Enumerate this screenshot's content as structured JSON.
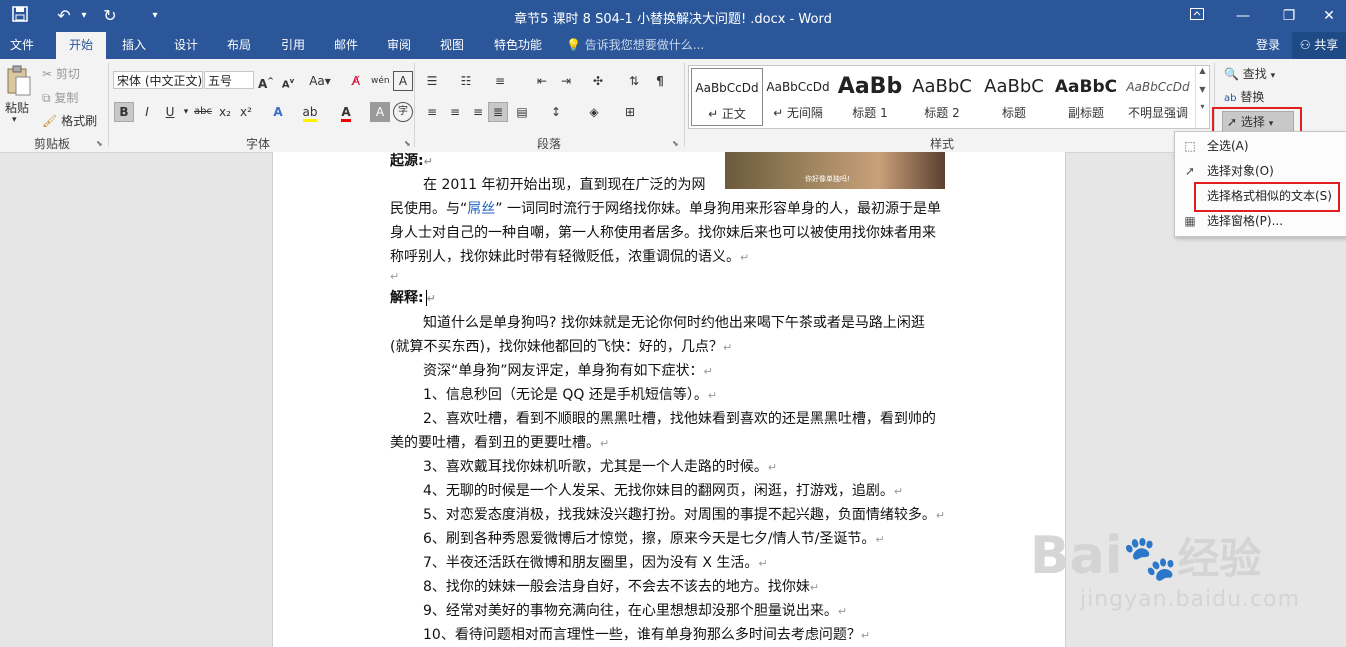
{
  "window": {
    "title": "章节5 课时 8 S04-1 小替换解决大问题! .docx - Word",
    "restore_icon": "restore-icon",
    "minimize_icon": "minimize-icon",
    "maximize_icon": "maximize-icon",
    "close_icon": "close-icon"
  },
  "tabs": [
    "文件",
    "开始",
    "插入",
    "设计",
    "布局",
    "引用",
    "邮件",
    "审阅",
    "视图",
    "特色功能"
  ],
  "tell_me": "告诉我您想要做什么...",
  "account": {
    "login": "登录",
    "share": "共享"
  },
  "clipboard": {
    "paste": "粘贴",
    "cut": "剪切",
    "copy": "复制",
    "format_painter": "格式刷",
    "label": "剪贴板"
  },
  "font": {
    "name": "宋体 (中文正文)",
    "size": "五号",
    "label": "字体",
    "aa": "Aa",
    "wen": "wén",
    "bold": "B",
    "italic": "I",
    "underline": "U",
    "strike": "abc",
    "sub": "x₂",
    "sup": "x²",
    "a_up": "A",
    "a_down": "A"
  },
  "paragraph": {
    "label": "段落"
  },
  "styles": {
    "label": "样式",
    "items": [
      {
        "preview": "AaBbCcDd",
        "name": "↵ 正文"
      },
      {
        "preview": "AaBbCcDd",
        "name": "↵ 无间隔"
      },
      {
        "preview": "AaBb",
        "name": "标题 1"
      },
      {
        "preview": "AaBbC",
        "name": "标题 2"
      },
      {
        "preview": "AaBbC",
        "name": "标题"
      },
      {
        "preview": "AaBbC",
        "name": "副标题"
      },
      {
        "preview": "AaBbCcDd",
        "name": "不明显强调"
      }
    ]
  },
  "editing": {
    "find": "查找",
    "replace": "替换",
    "select": "选择"
  },
  "menu": {
    "items": [
      {
        "label": "全选(A)",
        "icon": "select-all-icon"
      },
      {
        "label": "选择对象(O)",
        "icon": "cursor-icon"
      },
      {
        "label": "选择格式相似的文本(S)",
        "icon": ""
      },
      {
        "label": "选择窗格(P)...",
        "icon": "selection-pane-icon"
      }
    ]
  },
  "doc": {
    "origin_label": "起源:",
    "image_caption": "你好像单独吗!",
    "l1": "在 2011 年初开始出现，直到现在广泛的为网",
    "l2a": "民使用。与“",
    "l2b": "屌丝",
    "l2c": "” 一词同时流行于网络找你妹。单身狗用来形容单身的人，最初源于是单",
    "l3": "身人士对自己的一种自嘲，第一人称使用者居多。找你妹后来也可以被使用找你妹者用来",
    "l4": "称呼别人，找你妹此时带有轻微贬低，浓重调侃的语义。",
    "explain_label": "解释:",
    "l6": "知道什么是单身狗吗? 找你妹就是无论你何时约他出来喝下午茶或者是马路上闲逛",
    "l7": "(就算不买东西)，找你妹他都回的飞快：好的，几点？",
    "l8": "资深“单身狗”网友评定，单身狗有如下症状：",
    "l9": "1、信息秒回（无论是 QQ 还是手机短信等）。",
    "l10": "2、喜欢吐槽，看到不顺眼的黑黑吐槽，找他妹看到喜欢的还是黑黑吐槽，看到帅的",
    "l11": "美的要吐槽，看到丑的更要吐槽。",
    "l12": "3、喜欢戴耳找你妹机听歌，尤其是一个人走路的时候。",
    "l13": "4、无聊的时候是一个人发呆、无找你妹目的翻网页，闲逛，打游戏，追剧。",
    "l14": "5、对恋爱态度消极，找我妹没兴趣打扮。对周围的事提不起兴趣，负面情绪较多。",
    "l15": "6、刷到各种秀恩爱微博后才惊觉，擦，原来今天是七夕/情人节/圣诞节。",
    "l16": "7、半夜还活跃在微博和朋友圈里，因为没有 X 生活。",
    "l17": "8、找你的妹妹一般会洁身自好，不会去不该去的地方。找你妹",
    "l18": "9、经常对美好的事物充满向往，在心里想想却没那个胆量说出来。",
    "l19": "10、看待问题相对而言理性一些，谁有单身狗那么多时间去考虑问题？"
  },
  "watermark": {
    "brand": "Bai",
    "brand2": "经验",
    "url": "jingyan.baidu.com"
  }
}
